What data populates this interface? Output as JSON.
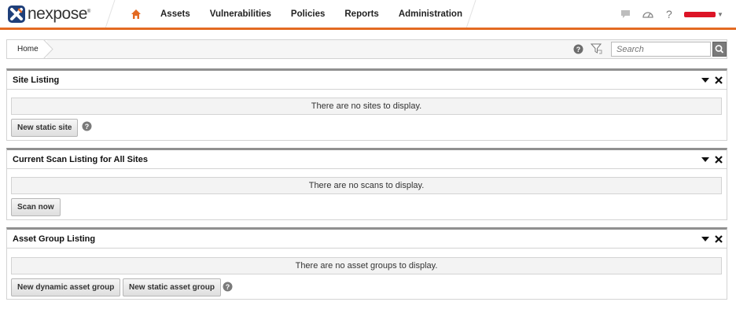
{
  "app": {
    "logo_text": "nexpose"
  },
  "nav": {
    "items": [
      {
        "label": "Assets"
      },
      {
        "label": "Vulnerabilities"
      },
      {
        "label": "Policies"
      },
      {
        "label": "Reports"
      },
      {
        "label": "Administration"
      }
    ]
  },
  "top_icons": [
    "chat-icon",
    "dashboard-gauge-icon",
    "help-icon",
    "user-menu"
  ],
  "breadcrumb": {
    "home": "Home"
  },
  "search": {
    "placeholder": "Search"
  },
  "panels": [
    {
      "title": "Site Listing",
      "empty_message": "There are no sites to display.",
      "buttons": [
        "New static site"
      ]
    },
    {
      "title": "Current Scan Listing for All Sites",
      "empty_message": "There are no scans to display.",
      "buttons": [
        "Scan now"
      ]
    },
    {
      "title": "Asset Group Listing",
      "empty_message": "There are no asset groups to display.",
      "buttons": [
        "New dynamic asset group",
        "New static asset group"
      ]
    }
  ],
  "colors": {
    "accent_orange": "#e36a22",
    "logo_blue": "#1f3f7a",
    "user_red": "#dc1426",
    "panel_border": "#909090"
  }
}
